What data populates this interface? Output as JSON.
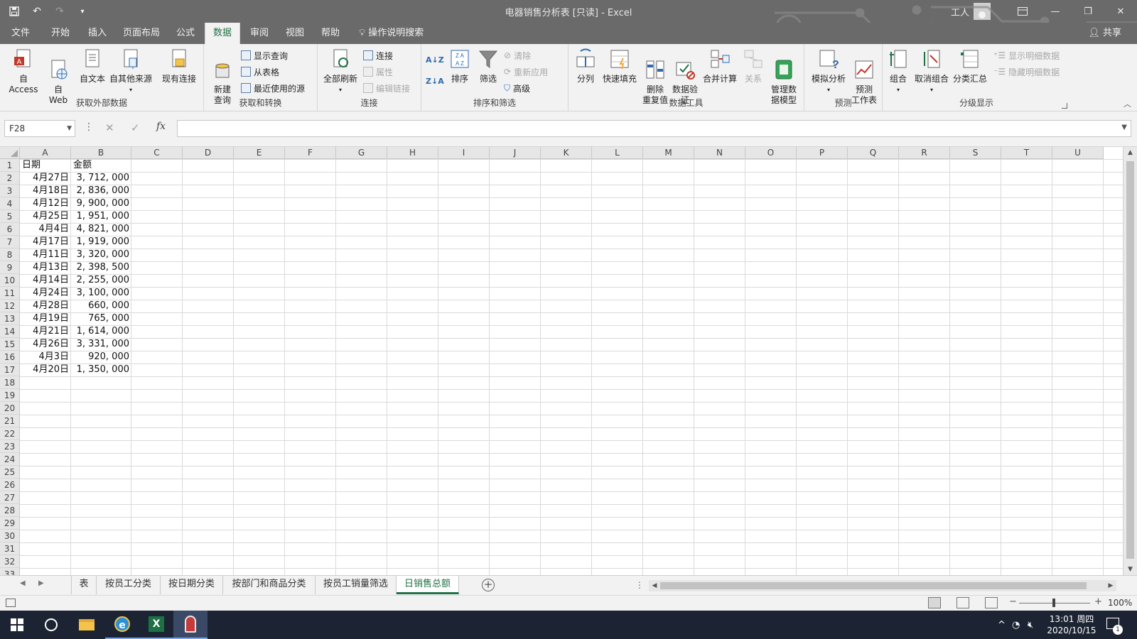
{
  "window": {
    "title": "电器销售分析表  [只读]  -  Excel",
    "user": "工人"
  },
  "menu": {
    "tabs": [
      {
        "label": "文件"
      },
      {
        "label": "开始"
      },
      {
        "label": "插入"
      },
      {
        "label": "页面布局"
      },
      {
        "label": "公式"
      },
      {
        "label": "数据"
      },
      {
        "label": "审阅"
      },
      {
        "label": "视图"
      },
      {
        "label": "帮助"
      }
    ],
    "tell_me": "操作说明搜索",
    "share": "共享"
  },
  "ribbon": {
    "get_external": {
      "label": "获取外部数据",
      "access": "自 Access",
      "web": "自\nWeb",
      "text": "自文本",
      "other": "自其他来源",
      "existing": "现有连接"
    },
    "get_transform": {
      "label": "获取和转换",
      "new_query": "新建\n查询",
      "show_queries": "显示查询",
      "from_table": "从表格",
      "recent": "最近使用的源"
    },
    "connections": {
      "label": "连接",
      "refresh_all": "全部刷新",
      "connections": "连接",
      "properties": "属性",
      "edit_links": "编辑链接"
    },
    "sort_filter": {
      "label": "排序和筛选",
      "sort": "排序",
      "filter": "筛选",
      "clear": "清除",
      "reapply": "重新应用",
      "advanced": "高级"
    },
    "data_tools": {
      "label": "数据工具",
      "split": "分列",
      "flash_fill": "快速填充",
      "remove_dup": "删除\n重复值",
      "validation": "数据验\n证",
      "consolidate": "合并计算",
      "relations": "关系",
      "data_model": "管理数\n据模型"
    },
    "forecast": {
      "label": "预测",
      "what_if": "模拟分析",
      "sheet": "预测\n工作表"
    },
    "outline": {
      "label": "分级显示",
      "group": "组合",
      "ungroup": "取消组合",
      "subtotal": "分类汇总",
      "show_detail": "显示明细数据",
      "hide_detail": "隐藏明细数据"
    }
  },
  "formula_bar": {
    "name_box": "F28",
    "fx": "fx",
    "value": ""
  },
  "sheet": {
    "columns": [
      "A",
      "B",
      "C",
      "D",
      "E",
      "F",
      "G",
      "H",
      "I",
      "J",
      "K",
      "L",
      "M",
      "N",
      "O",
      "P",
      "Q",
      "R",
      "S",
      "T",
      "U"
    ],
    "rows": [
      "1",
      "2",
      "3",
      "4",
      "5",
      "6",
      "7",
      "8",
      "9",
      "10",
      "11",
      "12",
      "13",
      "14",
      "15",
      "16",
      "17",
      "18",
      "19",
      "20",
      "21",
      "22",
      "23",
      "24",
      "25",
      "26",
      "27",
      "28",
      "29",
      "30",
      "31",
      "32",
      "33"
    ],
    "header": {
      "a": "日期",
      "b": "金额"
    },
    "data": [
      {
        "date": "4月27日",
        "amount": "3, 712, 000"
      },
      {
        "date": "4月18日",
        "amount": "2, 836, 000"
      },
      {
        "date": "4月12日",
        "amount": "9, 900, 000"
      },
      {
        "date": "4月25日",
        "amount": "1, 951, 000"
      },
      {
        "date": "4月4日",
        "amount": "4, 821, 000"
      },
      {
        "date": "4月17日",
        "amount": "1, 919, 000"
      },
      {
        "date": "4月11日",
        "amount": "3, 320, 000"
      },
      {
        "date": "4月13日",
        "amount": "2, 398, 500"
      },
      {
        "date": "4月14日",
        "amount": "2, 255, 000"
      },
      {
        "date": "4月24日",
        "amount": "3, 100, 000"
      },
      {
        "date": "4月28日",
        "amount": "660, 000"
      },
      {
        "date": "4月19日",
        "amount": "765, 000"
      },
      {
        "date": "4月21日",
        "amount": "1, 614, 000"
      },
      {
        "date": "4月26日",
        "amount": "3, 331, 000"
      },
      {
        "date": "4月3日",
        "amount": "920, 000"
      },
      {
        "date": "4月20日",
        "amount": "1, 350, 000"
      }
    ]
  },
  "sheet_tabs": [
    {
      "label": "表"
    },
    {
      "label": "按员工分类"
    },
    {
      "label": "按日期分类"
    },
    {
      "label": "按部门和商品分类"
    },
    {
      "label": "按员工销量筛选"
    },
    {
      "label": "日销售总额"
    }
  ],
  "status": {
    "zoom": "100%"
  },
  "taskbar": {
    "time": "13:01 周四",
    "date": "2020/10/15",
    "notifications": "1"
  },
  "colors": {
    "excel_green": "#217346",
    "title_bar": "#6a6a6a",
    "ribbon": "#f2f2f2",
    "taskbar": "#1c2433"
  }
}
